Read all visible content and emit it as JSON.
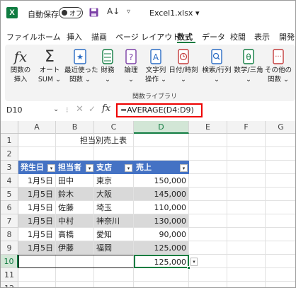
{
  "titlebar": {
    "logo": "X",
    "autosave_label": "自動保存",
    "toggle_label": "オフ",
    "filename": "Excel1.xlsx"
  },
  "tabs": [
    "ファイル",
    "ホーム",
    "挿入",
    "描画",
    "ページ レイアウト",
    "数式",
    "データ",
    "校閲",
    "表示",
    "開発"
  ],
  "active_tab": "数式",
  "ribbon": {
    "buttons": [
      {
        "l1": "関数の",
        "l2": "挿入"
      },
      {
        "l1": "オート",
        "l2": "SUM ⌄"
      },
      {
        "l1": "最近使った",
        "l2": "関数 ⌄"
      },
      {
        "l1": "財務",
        "l2": "⌄"
      },
      {
        "l1": "論理",
        "l2": "⌄"
      },
      {
        "l1": "文字列",
        "l2": "操作 ⌄"
      },
      {
        "l1": "日付/時刻",
        "l2": "⌄"
      },
      {
        "l1": "検索/行列",
        "l2": "⌄"
      },
      {
        "l1": "数学/三角",
        "l2": "⌄"
      },
      {
        "l1": "その他の",
        "l2": "関数 ⌄"
      }
    ],
    "group_label": "関数ライブラリ"
  },
  "formula_bar": {
    "name_box": "D10",
    "formula": "=AVERAGE(D4:D9)"
  },
  "columns": [
    "A",
    "B",
    "C",
    "D",
    "E",
    "F",
    "G"
  ],
  "rows": [
    "1",
    "2",
    "3",
    "4",
    "5",
    "6",
    "7",
    "8",
    "9",
    "10",
    "11",
    "12"
  ],
  "sheet": {
    "title": "担当別売上表",
    "headers": [
      "発生日",
      "担当者",
      "支店",
      "売上"
    ],
    "data": [
      [
        "1月5日",
        "田中",
        "東京",
        "150,000"
      ],
      [
        "1月5日",
        "鈴木",
        "大阪",
        "145,000"
      ],
      [
        "1月5日",
        "佐藤",
        "埼玉",
        "110,000"
      ],
      [
        "1月5日",
        "中村",
        "神奈川",
        "130,000"
      ],
      [
        "1月5日",
        "高橋",
        "愛知",
        "90,000"
      ],
      [
        "1月5日",
        "伊藤",
        "福岡",
        "125,000"
      ]
    ],
    "result": "125,000"
  },
  "colors": {
    "excel_green": "#107c41",
    "table_header": "#4472c4",
    "band_row": "#d9d9d9",
    "highlight_box": "#e00000"
  }
}
